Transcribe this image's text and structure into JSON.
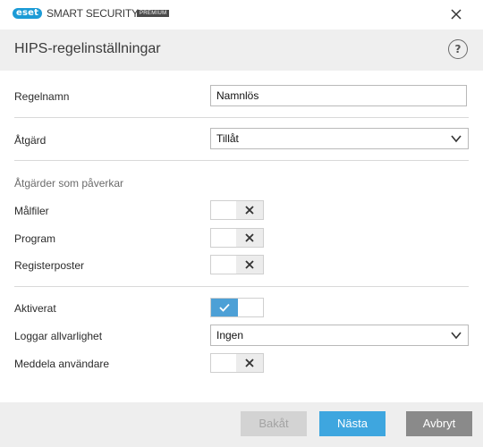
{
  "app": {
    "logo": "eset",
    "brand": "SMART SECURITY",
    "edition": "PREMIUM"
  },
  "dialog": {
    "title": "HIPS-regelinställningar",
    "help_icon": "?"
  },
  "form": {
    "rule_name_label": "Regelnamn",
    "rule_name_value": "Namnlös",
    "action_label": "Åtgärd",
    "action_value": "Tillåt",
    "affecting_section": "Åtgärder som påverkar",
    "target_files_label": "Målfiler",
    "target_files_enabled": false,
    "applications_label": "Program",
    "applications_enabled": false,
    "registry_label": "Registerposter",
    "registry_enabled": false,
    "enabled_label": "Aktiverat",
    "enabled_value": true,
    "log_severity_label": "Loggar allvarlighet",
    "log_severity_value": "Ingen",
    "notify_user_label": "Meddela användare",
    "notify_user_enabled": false
  },
  "footer": {
    "back_label": "Bakåt",
    "next_label": "Nästa",
    "cancel_label": "Avbryt"
  },
  "colors": {
    "accent": "#3ea6df",
    "toggle_on": "#4da0d6",
    "header_bg": "#efefef",
    "footer_bg": "#eeeeee"
  }
}
